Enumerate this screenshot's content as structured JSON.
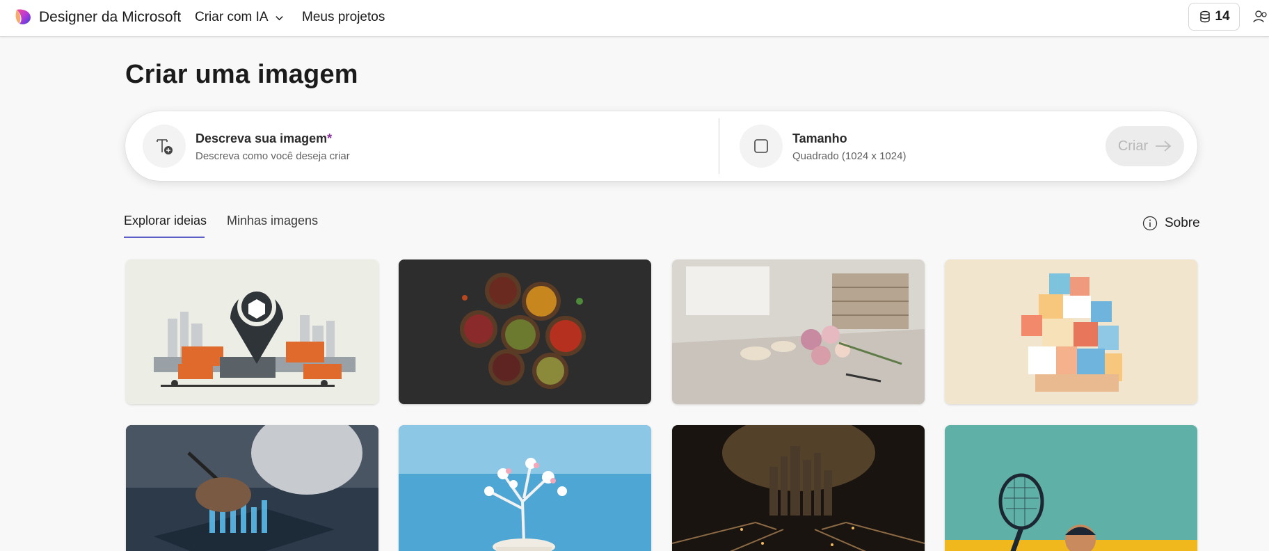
{
  "header": {
    "app_name": "Designer da Microsoft",
    "nav_create": "Criar com IA",
    "nav_projects": "Meus projetos",
    "credits": "14",
    "logo_icon": "designer-logo",
    "account_icon": "account-switch-icon"
  },
  "page": {
    "title": "Criar uma imagem"
  },
  "prompt": {
    "description_label": "Descreva sua imagem",
    "description_required_mark": "*",
    "description_placeholder": "Descreva como você deseja criar",
    "size_label": "Tamanho",
    "size_value": "Quadrado (1024 x 1024)",
    "create_button": "Criar"
  },
  "tabs": [
    {
      "label": "Explorar ideias",
      "active": true
    },
    {
      "label": "Minhas imagens",
      "active": false
    }
  ],
  "about_label": "Sobre",
  "gallery": [
    {
      "icon": "logistics-location-pin-image"
    },
    {
      "icon": "spice-bowls-image"
    },
    {
      "icon": "flower-workshop-image"
    },
    {
      "icon": "isometric-blocks-tower-image"
    },
    {
      "icon": "digital-tablet-city-image"
    },
    {
      "icon": "blossom-tree-image"
    },
    {
      "icon": "circuit-city-image"
    },
    {
      "icon": "tennis-player-illustration-image"
    }
  ],
  "colors": {
    "accent": "#5b5fc7",
    "required_mark": "#8a2d9c",
    "background": "#f8f8f8"
  }
}
